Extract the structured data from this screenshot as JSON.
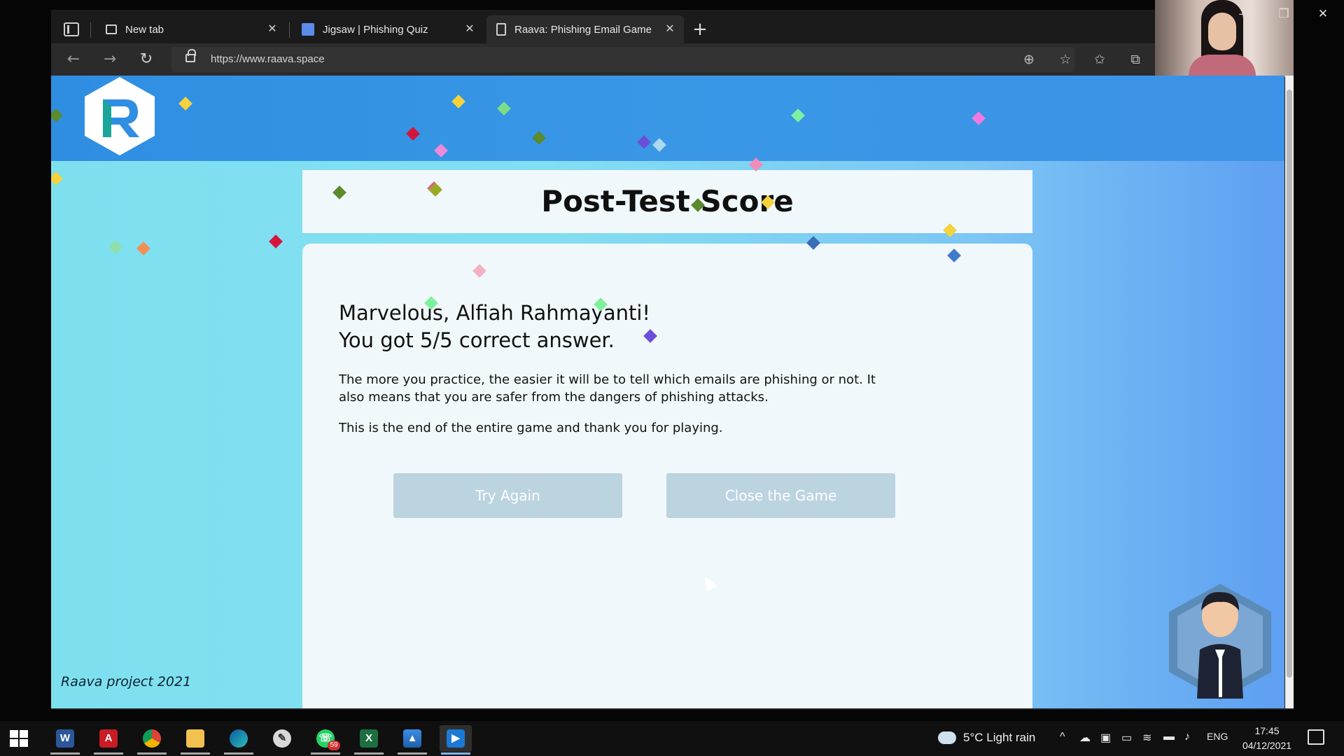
{
  "browser": {
    "tabs": [
      {
        "title": "New tab",
        "icon": "new-tab-page-icon"
      },
      {
        "title": "Jigsaw | Phishing Quiz",
        "icon": "jigsaw-favicon"
      },
      {
        "title": "Raava: Phishing Email Game",
        "icon": "document-icon"
      }
    ],
    "address": "https://www.raava.space"
  },
  "page": {
    "title": "Post-Test Score",
    "greeting_line1": "Marvelous, Alfiah Rahmayanti!",
    "greeting_line2": "You got 5/5 correct answer.",
    "body": "The more you practice, the easier it will be to tell which emails are phishing or not. It also means that you are safer from the dangers of phishing attacks.",
    "end_text": "This is the end of the entire game and thank you for playing.",
    "try_again_label": "Try Again",
    "close_game_label": "Close the Game",
    "footer": "Raava project 2021",
    "colors": {
      "header": "#3a97e6",
      "card": "#f1f8fb",
      "button": "#bcd4e0"
    }
  },
  "taskbar": {
    "apps": [
      "word",
      "acrobat",
      "chrome",
      "file-explorer",
      "edge",
      "paint",
      "whatsapp",
      "excel",
      "photos",
      "media-player"
    ],
    "whatsapp_badge": "59",
    "weather": "5°C  Light rain",
    "language": "ENG",
    "time": "17:45",
    "date": "04/12/2021"
  }
}
